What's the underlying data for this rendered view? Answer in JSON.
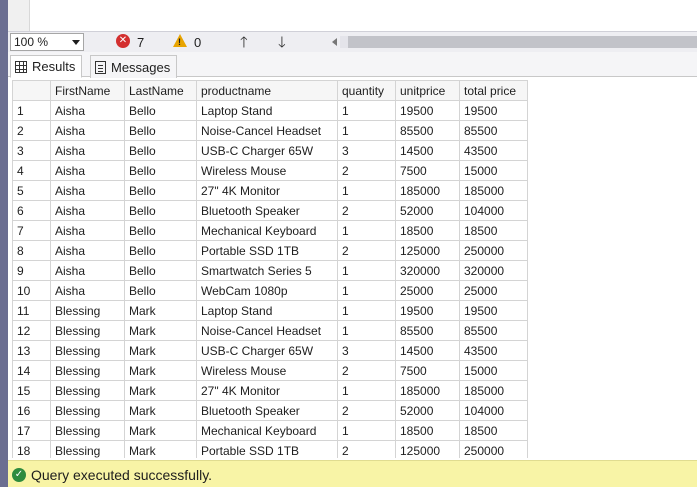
{
  "toolbar": {
    "zoom": "100 %",
    "error_count": "7",
    "warning_count": "0"
  },
  "tabs": {
    "results": "Results",
    "messages": "Messages"
  },
  "grid": {
    "columns": [
      "FirstName",
      "LastName",
      "productname",
      "quantity",
      "unitprice",
      "total price"
    ],
    "rows": [
      [
        "1",
        "Aisha",
        "Bello",
        " Laptop Stand",
        "1",
        "19500",
        "19500"
      ],
      [
        "2",
        "Aisha",
        "Bello",
        " Noise-Cancel Headset",
        "1",
        "85500",
        "85500"
      ],
      [
        "3",
        "Aisha",
        "Bello",
        " USB-C Charger 65W",
        "3",
        "14500",
        "43500"
      ],
      [
        "4",
        "Aisha",
        "Bello",
        " Wireless Mouse",
        "2",
        "7500",
        "15000"
      ],
      [
        "5",
        "Aisha",
        "Bello",
        "27\" 4K Monitor",
        "1",
        "185000",
        "185000"
      ],
      [
        "6",
        "Aisha",
        "Bello",
        "Bluetooth Speaker",
        "2",
        "52000",
        "104000"
      ],
      [
        "7",
        "Aisha",
        "Bello",
        "Mechanical Keyboard",
        "1",
        "18500",
        "18500"
      ],
      [
        "8",
        "Aisha",
        "Bello",
        "Portable SSD 1TB",
        "2",
        "125000",
        "250000"
      ],
      [
        "9",
        "Aisha",
        "Bello",
        "Smartwatch Series 5",
        "1",
        "320000",
        "320000"
      ],
      [
        "10",
        "Aisha",
        "Bello",
        "WebCam 1080p",
        "1",
        "25000",
        "25000"
      ],
      [
        "11",
        "Blessing",
        "Mark",
        " Laptop Stand",
        "1",
        "19500",
        "19500"
      ],
      [
        "12",
        "Blessing",
        "Mark",
        " Noise-Cancel Headset",
        "1",
        "85500",
        "85500"
      ],
      [
        "13",
        "Blessing",
        "Mark",
        " USB-C Charger 65W",
        "3",
        "14500",
        "43500"
      ],
      [
        "14",
        "Blessing",
        "Mark",
        " Wireless Mouse",
        "2",
        "7500",
        "15000"
      ],
      [
        "15",
        "Blessing",
        "Mark",
        "27\" 4K Monitor",
        "1",
        "185000",
        "185000"
      ],
      [
        "16",
        "Blessing",
        "Mark",
        "Bluetooth Speaker",
        "2",
        "52000",
        "104000"
      ],
      [
        "17",
        "Blessing",
        "Mark",
        "Mechanical Keyboard",
        "1",
        "18500",
        "18500"
      ],
      [
        "18",
        "Blessing",
        "Mark",
        "Portable SSD 1TB",
        "2",
        "125000",
        "250000"
      ]
    ]
  },
  "status": {
    "message": "Query executed successfully."
  }
}
